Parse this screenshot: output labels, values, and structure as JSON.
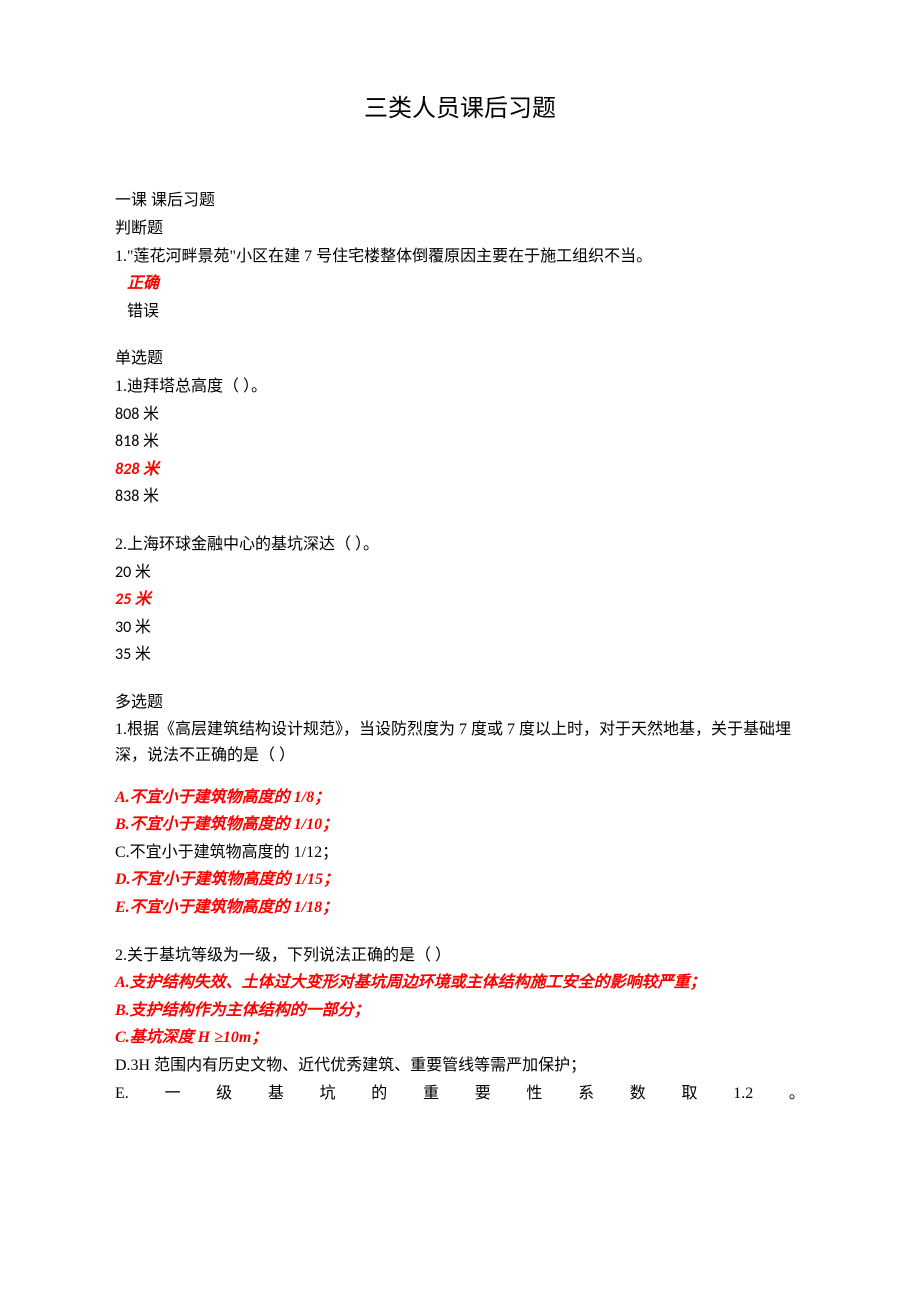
{
  "title": "三类人员课后习题",
  "lesson_header": "一课 课后习题",
  "sections": {
    "tf": {
      "label": "判断题",
      "q1": {
        "text": "1.\"莲花河畔景苑\"小区在建 7 号住宅楼整体倒覆原因主要在于施工组织不当。",
        "opt_correct": "正确",
        "opt_wrong": "错误"
      }
    },
    "single": {
      "label": "单选题",
      "q1": {
        "text": "1.迪拜塔总高度（ ）。",
        "a": "808 米",
        "b": "818 米",
        "c": "828 米",
        "d": "838 米"
      },
      "q2": {
        "text": "2.上海环球金融中心的基坑深达（ ）。",
        "a": "20 米",
        "b": "25 米",
        "c": "30 米",
        "d": "35 米"
      }
    },
    "multi": {
      "label": "多选题",
      "q1": {
        "text": "1.根据《高层建筑结构设计规范》，当设防烈度为 7 度或 7 度以上时，对于天然地基，关于基础埋深，说法不正确的是（ ）",
        "a": "A.不宜小于建筑物高度的 1/8；",
        "b": "B.不宜小于建筑物高度的 1/10；",
        "c": "C.不宜小于建筑物高度的 1/12；",
        "d": "D.不宜小于建筑物高度的 1/15；",
        "e": "E.不宜小于建筑物高度的 1/18；"
      },
      "q2": {
        "text": "2.关于基坑等级为一级，下列说法正确的是（ ）",
        "a": "A.支护结构失效、土体过大变形对基坑周边环境或主体结构施工安全的影响较严重；",
        "b": "B.支护结构作为主体结构的一部分；",
        "c": "C.基坑深度 H ≥10m；",
        "d": "D.3H 范围内有历史文物、近代优秀建筑、重要管线等需严加保护；",
        "e_parts": [
          "E.",
          "一",
          "级",
          "基",
          "坑",
          "的",
          "重",
          "要",
          "性",
          "系",
          "数",
          "取",
          "1.2",
          "。"
        ]
      }
    }
  }
}
